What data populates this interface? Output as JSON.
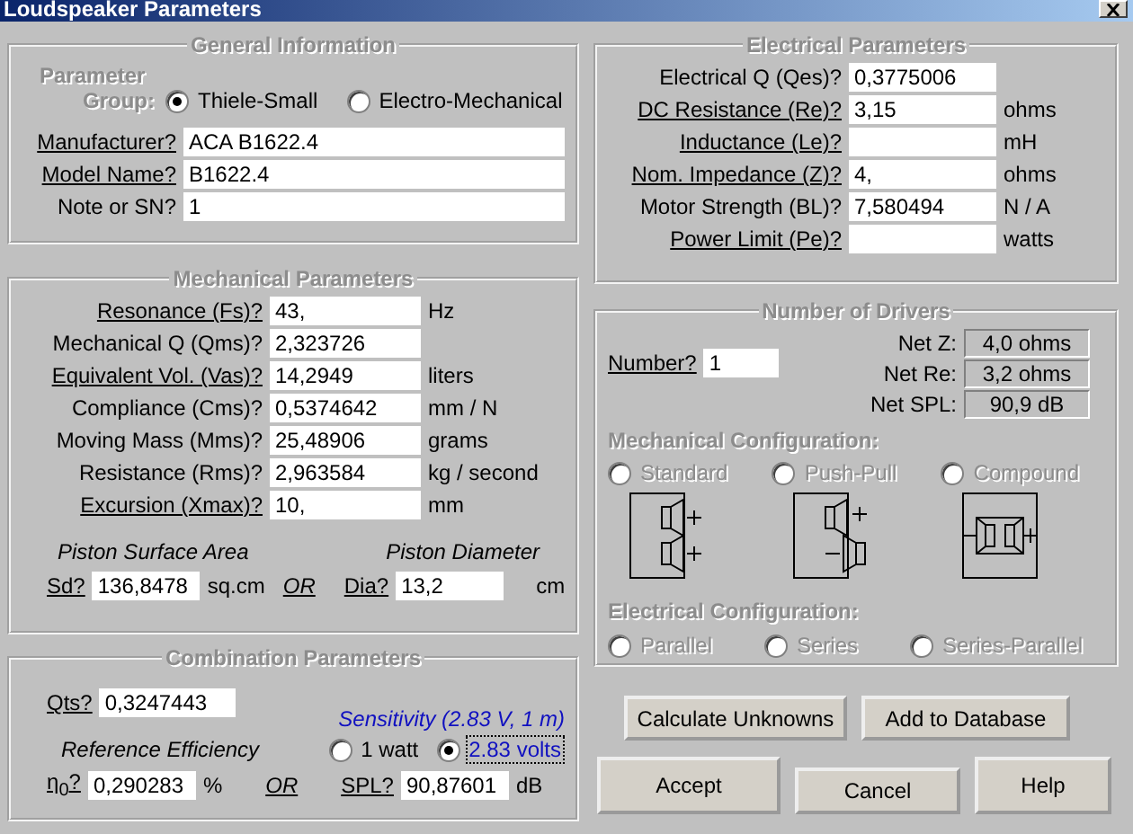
{
  "window": {
    "title": "Loudspeaker Parameters"
  },
  "general": {
    "title": "General Information",
    "group_label": [
      "Parameter",
      "Group:"
    ],
    "options": [
      {
        "label": "Thiele-Small",
        "selected": true
      },
      {
        "label": "Electro-Mechanical",
        "selected": false
      }
    ],
    "fields": [
      {
        "label": "Manufacturer?",
        "underlined": true,
        "value": "ACA B1622.4"
      },
      {
        "label": "Model Name?",
        "underlined": true,
        "value": "B1622.4"
      },
      {
        "label": "Note or SN?",
        "underlined": false,
        "value": "1"
      }
    ]
  },
  "mechanical": {
    "title": "Mechanical Parameters",
    "fields": [
      {
        "label": "Resonance (Fs)?",
        "underlined": true,
        "value": "43,",
        "unit": "Hz"
      },
      {
        "label": "Mechanical Q (Qms)?",
        "underlined": false,
        "value": "2,323726"
      },
      {
        "label": "Equivalent Vol. (Vas)?",
        "underlined": true,
        "value": "14,2949",
        "unit": "liters"
      },
      {
        "label": "Compliance (Cms)?",
        "underlined": false,
        "value": "0,5374642",
        "unit": "mm / N"
      },
      {
        "label": "Moving Mass (Mms)?",
        "underlined": false,
        "value": "25,48906",
        "unit": "grams"
      },
      {
        "label": "Resistance (Rms)?",
        "underlined": false,
        "value": "2,963584",
        "unit": "kg / second"
      },
      {
        "label": "Excursion (Xmax)?",
        "underlined": true,
        "value": "10,",
        "unit": "mm"
      }
    ],
    "area_label": "Piston Surface Area",
    "diameter_label": "Piston Diameter",
    "sd": {
      "label": "Sd?",
      "value": "136,8478",
      "unit": "sq.cm"
    },
    "or": "OR",
    "dia": {
      "label": "Dia?",
      "value": "13,2",
      "unit": "cm"
    }
  },
  "combination": {
    "title": "Combination Parameters",
    "qts": {
      "label": "Qts?",
      "value": "0,3247443"
    },
    "sensitivity_label": "Sensitivity (2.83 V, 1 m)",
    "efficiency_label": "Reference Efficiency",
    "options": [
      {
        "label": "1 watt",
        "selected": false
      },
      {
        "label": "2.83 volts",
        "selected": true
      }
    ],
    "efficiency": {
      "label": "η$_{0}$?",
      "value": "0,290283",
      "unit": "%"
    },
    "or": "OR",
    "spl": {
      "label": "SPL?",
      "value": "90,87601",
      "unit": "dB"
    }
  },
  "electrical": {
    "title": "Electrical Parameters",
    "fields": [
      {
        "label": "Electrical Q (Qes)?",
        "underlined": false,
        "value": "0,3775006"
      },
      {
        "label": "DC Resistance (Re)?",
        "underlined": true,
        "value": "3,15",
        "unit": "ohms"
      },
      {
        "label": "Inductance (Le)?",
        "underlined": true,
        "unit": "mH"
      },
      {
        "label": "Nom. Impedance (Z)?",
        "underlined": true,
        "value": "4,",
        "unit": "ohms"
      },
      {
        "label": "Motor Strength (BL)?",
        "underlined": false,
        "value": "7,580494",
        "unit": "N / A"
      },
      {
        "label": "Power Limit (Pe)?",
        "underlined": true,
        "unit": "watts"
      }
    ]
  },
  "drivers": {
    "title": "Number of Drivers",
    "number": {
      "label": "Number?",
      "value": "1"
    },
    "net": [
      {
        "label": "Net Z:",
        "value": "4,0 ohms"
      },
      {
        "label": "Net Re:",
        "value": "3,2 ohms"
      },
      {
        "label": "Net SPL:",
        "value": "90,9 dB"
      }
    ],
    "mech_label": "Mechanical Configuration:",
    "mech_options": [
      {
        "label": "Standard",
        "kind": "standard",
        "selected": false,
        "disabled": true
      },
      {
        "label": "Push-Pull",
        "kind": "push-pull",
        "selected": false,
        "disabled": true
      },
      {
        "label": "Compound",
        "kind": "compound",
        "selected": false,
        "disabled": true
      }
    ],
    "elec_label": "Electrical Configuration:",
    "elec_options": [
      {
        "label": "Parallel",
        "selected": false,
        "disabled": true
      },
      {
        "label": "Series",
        "selected": false,
        "disabled": true
      },
      {
        "label": "Series-Parallel",
        "selected": false,
        "disabled": true
      }
    ]
  },
  "buttons": {
    "row_1": [
      "Calculate Unknowns",
      "Add to Database"
    ],
    "row_2": [
      "Accept",
      "Cancel",
      "Help"
    ]
  }
}
